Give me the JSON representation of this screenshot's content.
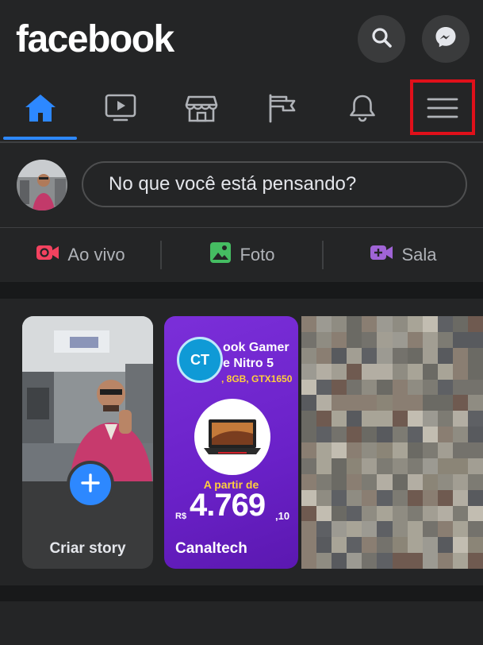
{
  "header": {
    "logo": "facebook",
    "search_icon": "search-icon",
    "messenger_icon": "messenger-icon"
  },
  "nav": {
    "tabs": [
      {
        "name": "home",
        "icon": "home-icon",
        "active": true
      },
      {
        "name": "watch",
        "icon": "video-icon",
        "active": false
      },
      {
        "name": "marketplace",
        "icon": "store-icon",
        "active": false
      },
      {
        "name": "pages",
        "icon": "flag-icon",
        "active": false
      },
      {
        "name": "notifications",
        "icon": "bell-icon",
        "active": false
      },
      {
        "name": "menu",
        "icon": "hamburger-menu-icon",
        "active": false,
        "highlighted": true
      }
    ],
    "active_color": "#2d88ff",
    "highlight_color": "#e0101a"
  },
  "composer": {
    "placeholder": "No que você está pensando?"
  },
  "actions": {
    "live_label": "Ao vivo",
    "photo_label": "Foto",
    "room_label": "Sala",
    "live_color": "#f3425f",
    "photo_color": "#45bd62",
    "room_color": "#a064d6"
  },
  "stories": {
    "create_label": "Criar story",
    "ad": {
      "title_line1": "ook Gamer",
      "title_line2": "e Nitro 5",
      "spec": ", 8GB, GTX1650",
      "price_prefix": "A partir de",
      "currency": "R$",
      "price": "4.769",
      "cents": ",10",
      "brand": "Canaltech",
      "logo_letters": "CT"
    }
  }
}
